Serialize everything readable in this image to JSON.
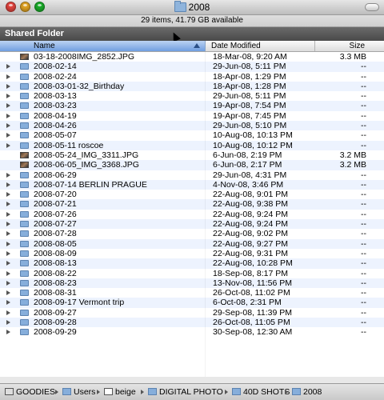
{
  "window": {
    "title": "2008",
    "status": "29 items, 41.79 GB available"
  },
  "sidebar_section": "Shared Folder",
  "columns": {
    "name": "Name",
    "date": "Date Modified",
    "size": "Size"
  },
  "rows": [
    {
      "name": "03-18-2008IMG_2852.JPG",
      "date": "18-Mar-08, 9:20 AM",
      "size": "3.3 MB",
      "kind": "image"
    },
    {
      "name": "2008-02-14",
      "date": "29-Jun-08, 5:11 PM",
      "size": "--",
      "kind": "folder"
    },
    {
      "name": "2008-02-24",
      "date": "18-Apr-08, 1:29 PM",
      "size": "--",
      "kind": "folder"
    },
    {
      "name": "2008-03-01-32_Birthday",
      "date": "18-Apr-08, 1:28 PM",
      "size": "--",
      "kind": "folder"
    },
    {
      "name": "2008-03-13",
      "date": "29-Jun-08, 5:11 PM",
      "size": "--",
      "kind": "folder"
    },
    {
      "name": "2008-03-23",
      "date": "19-Apr-08, 7:54 PM",
      "size": "--",
      "kind": "folder"
    },
    {
      "name": "2008-04-19",
      "date": "19-Apr-08, 7:45 PM",
      "size": "--",
      "kind": "folder"
    },
    {
      "name": "2008-04-26",
      "date": "29-Jun-08, 5:10 PM",
      "size": "--",
      "kind": "folder"
    },
    {
      "name": "2008-05-07",
      "date": "10-Aug-08, 10:13 PM",
      "size": "--",
      "kind": "folder"
    },
    {
      "name": "2008-05-11 roscoe",
      "date": "10-Aug-08, 10:12 PM",
      "size": "--",
      "kind": "folder"
    },
    {
      "name": "2008-05-24_IMG_3311.JPG",
      "date": "6-Jun-08, 2:19 PM",
      "size": "3.2 MB",
      "kind": "image"
    },
    {
      "name": "2008-06-05_IMG_3368.JPG",
      "date": "6-Jun-08, 2:17 PM",
      "size": "3.2 MB",
      "kind": "image"
    },
    {
      "name": "2008-06-29",
      "date": "29-Jun-08, 4:31 PM",
      "size": "--",
      "kind": "folder"
    },
    {
      "name": "2008-07-14 BERLIN PRAGUE",
      "date": "4-Nov-08, 3:46 PM",
      "size": "--",
      "kind": "folder"
    },
    {
      "name": "2008-07-20",
      "date": "22-Aug-08, 9:01 PM",
      "size": "--",
      "kind": "folder"
    },
    {
      "name": "2008-07-21",
      "date": "22-Aug-08, 9:38 PM",
      "size": "--",
      "kind": "folder"
    },
    {
      "name": "2008-07-26",
      "date": "22-Aug-08, 9:24 PM",
      "size": "--",
      "kind": "folder"
    },
    {
      "name": "2008-07-27",
      "date": "22-Aug-08, 9:24 PM",
      "size": "--",
      "kind": "folder"
    },
    {
      "name": "2008-07-28",
      "date": "22-Aug-08, 9:02 PM",
      "size": "--",
      "kind": "folder"
    },
    {
      "name": "2008-08-05",
      "date": "22-Aug-08, 9:27 PM",
      "size": "--",
      "kind": "folder"
    },
    {
      "name": "2008-08-09",
      "date": "22-Aug-08, 9:31 PM",
      "size": "--",
      "kind": "folder"
    },
    {
      "name": "2008-08-13",
      "date": "22-Aug-08, 10:28 PM",
      "size": "--",
      "kind": "folder"
    },
    {
      "name": "2008-08-22",
      "date": "18-Sep-08, 8:17 PM",
      "size": "--",
      "kind": "folder"
    },
    {
      "name": "2008-08-23",
      "date": "13-Nov-08, 11:56 PM",
      "size": "--",
      "kind": "folder"
    },
    {
      "name": "2008-08-31",
      "date": "26-Oct-08, 11:02 PM",
      "size": "--",
      "kind": "folder"
    },
    {
      "name": "2008-09-17 Vermont trip",
      "date": "6-Oct-08, 2:31 PM",
      "size": "--",
      "kind": "folder"
    },
    {
      "name": "2008-09-27",
      "date": "29-Sep-08, 11:39 PM",
      "size": "--",
      "kind": "folder"
    },
    {
      "name": "2008-09-28",
      "date": "26-Oct-08, 11:05 PM",
      "size": "--",
      "kind": "folder"
    },
    {
      "name": "2008-09-29",
      "date": "30-Sep-08, 12:30 AM",
      "size": "--",
      "kind": "folder"
    }
  ],
  "path": [
    {
      "label": "GOODIES",
      "icon": "drive-icon"
    },
    {
      "label": "Users",
      "icon": "folder-icon"
    },
    {
      "label": "beige",
      "icon": "home-icon"
    },
    {
      "label": "DIGITAL PHOTO",
      "icon": "folder-icon"
    },
    {
      "label": "40D SHOTS",
      "icon": "folder-icon"
    },
    {
      "label": "2008",
      "icon": "folder-icon"
    }
  ],
  "colors": {
    "close": "#e0443e",
    "minimize": "#dea123",
    "zoom": "#1aab29",
    "selected_header": "#7aa6e3",
    "alt_row": "#edf3fe"
  }
}
